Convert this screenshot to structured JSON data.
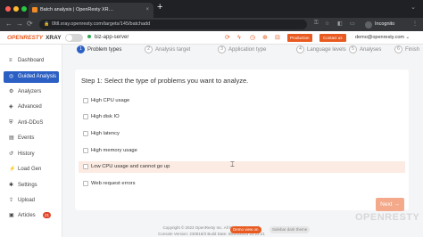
{
  "browser": {
    "tab_title": "Batch analysis | OpenResty XR…",
    "tab_close": "×",
    "new_tab": "+",
    "url": "0ltll.xray.openresty.com/targets/145/batchadd",
    "profile_label": "Incognito",
    "back": "←",
    "forward": "→",
    "reload": "⟳",
    "lock": "🔒"
  },
  "header": {
    "logo_text": "OPENRESTY",
    "logo_suffix": "XRAY",
    "server_name": "biz-app-server",
    "env_badge": "Production",
    "contact_label": "Contact us",
    "user_email": "demo@openresty.com",
    "accent_color": "#e85a20"
  },
  "sidebar": {
    "items": [
      {
        "label": "Dashboard",
        "icon": "≡"
      },
      {
        "label": "Guided Analysis",
        "icon": "◎"
      },
      {
        "label": "Analyzers",
        "icon": "⚙"
      },
      {
        "label": "Advanced",
        "icon": "◈"
      },
      {
        "label": "Anti-DDoS",
        "icon": "⛨"
      },
      {
        "label": "Events",
        "icon": "▤"
      },
      {
        "label": "History",
        "icon": "↺"
      },
      {
        "label": "Load Gen",
        "icon": "⚡"
      },
      {
        "label": "Settings",
        "icon": "✱"
      },
      {
        "label": "Upload",
        "icon": "⇪"
      },
      {
        "label": "Articles",
        "icon": "▣",
        "badge": "21"
      }
    ]
  },
  "steps": [
    {
      "num": "1",
      "label": "Problem types"
    },
    {
      "num": "2",
      "label": "Analysis target"
    },
    {
      "num": "3",
      "label": "Application type"
    },
    {
      "num": "4",
      "label": "Language levels"
    },
    {
      "num": "5",
      "label": "Analyses"
    },
    {
      "num": "6",
      "label": "Finish"
    }
  ],
  "main": {
    "title": "Step 1: Select the type of problems you want to analyze.",
    "options": [
      "High CPU usage",
      "High disk IO",
      "High latency",
      "High memory usage",
      "Low CPU usage and cannot go up",
      "Web request errors"
    ],
    "next_label": "Next →"
  },
  "footer": {
    "copyright": "Copyright © 2023 OpenResty Inc. All Rights Reserved.",
    "version": "Console Version: 230818/3 Build Date: 08/24/2023 22:22:21",
    "demo_view": "Demo view on",
    "ref_toggle": "Sidebar dark theme"
  },
  "watermark": "OPENRESTY"
}
